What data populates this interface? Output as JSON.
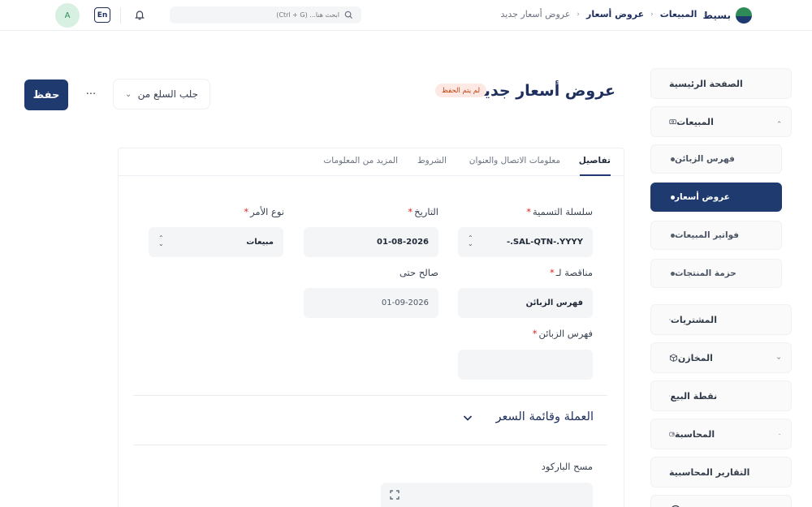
{
  "topbar": {
    "brand": "بسيط",
    "breadcrumbs": [
      "المبيعات",
      "عروض أسعار",
      "عروض أسعار جديد"
    ],
    "search_placeholder": "ابحث هنا... (Ctrl + G)",
    "lang": "En",
    "avatar_initial": "A"
  },
  "sidebar": {
    "items": [
      {
        "label": "الصفحة الرئيسية",
        "icon": "home-icon"
      },
      {
        "label": "المبيعات",
        "icon": "money-icon",
        "expanded": true
      },
      {
        "label": "المشتريات",
        "icon": "purchases-icon"
      },
      {
        "label": "المخازن",
        "icon": "box-icon"
      },
      {
        "label": "نقطة البيع",
        "icon": "store-icon"
      },
      {
        "label": "المحاسبة",
        "icon": "wallet-icon"
      },
      {
        "label": "التقارير المحاسبية",
        "icon": "report-icon"
      }
    ],
    "sub_items": [
      {
        "label": "فهرس الزبائن"
      },
      {
        "label": "عروض أسعار",
        "active": true
      },
      {
        "label": "فواتير المبيعات"
      },
      {
        "label": "حزمة المنتجات"
      }
    ]
  },
  "header": {
    "title": "عروض أسعار جديد",
    "status_badge": "لم يتم الحفظ",
    "fetch_label": "جلب السلع من",
    "more_label": "···",
    "save_label": "حفظ"
  },
  "tabs": [
    "تفاصيل",
    "معلومات الاتصال والعنوان",
    "الشروط",
    "المزيد من المعلومات"
  ],
  "form": {
    "naming_series": {
      "label": "سلسلة التسمية",
      "value": "SAL-QTN-.YYYY.-"
    },
    "date": {
      "label": "التاريخ",
      "value": "01-08-2026"
    },
    "order_type": {
      "label": "نوع الأمر",
      "value": "مبيعات"
    },
    "quotation_to": {
      "label": "مناقصة لـ",
      "value": "فهرس الزبائن"
    },
    "valid_till": {
      "label": "صالح حتى",
      "value": "01-09-2026"
    },
    "customer": {
      "label": "فهرس الزبائن",
      "value": ""
    },
    "section_currency": "العملة وقائمة السعر",
    "barcode": {
      "label": "مسح الباركود"
    },
    "required_mark": "*"
  },
  "colors": {
    "primary": "#1e3a6e",
    "required": "#dc2626",
    "badge_bg": "#fde8e3"
  }
}
